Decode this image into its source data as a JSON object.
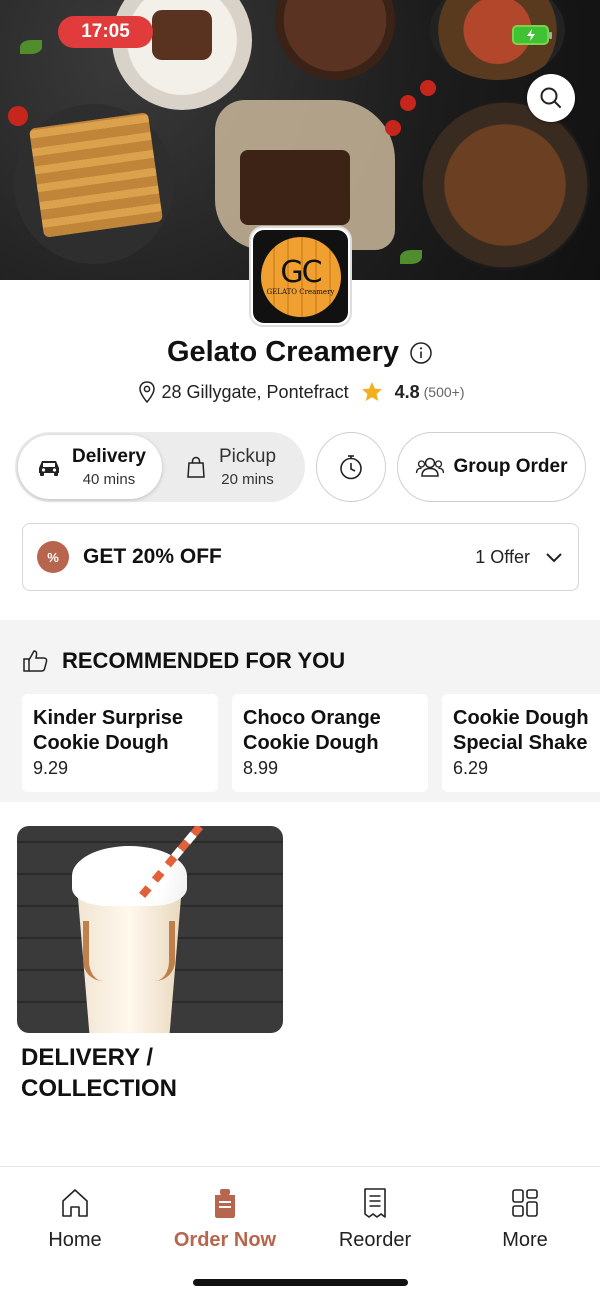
{
  "status_bar": {
    "time": "17:05",
    "battery_icon": "battery-charging-icon"
  },
  "header": {
    "search_icon": "search-icon"
  },
  "store": {
    "name": "Gelato Creamery",
    "logo_text": "GC",
    "logo_subtext": "GELATO Creamery",
    "address": "28 Gillygate, Pontefract",
    "rating": "4.8",
    "reviews": "(500+)"
  },
  "modes": {
    "delivery": {
      "label": "Delivery",
      "time": "40 mins"
    },
    "pickup": {
      "label": "Pickup",
      "time": "20 mins"
    },
    "group_order": "Group Order"
  },
  "offer": {
    "badge": "%",
    "title": "GET 20% OFF",
    "count": "1 Offer"
  },
  "recommended": {
    "title": "RECOMMENDED FOR YOU",
    "items": [
      {
        "name": "Kinder Surprise Cookie Dough",
        "price": "9.29"
      },
      {
        "name": "Choco Orange Cookie Dough",
        "price": "8.99"
      },
      {
        "name": "Cookie Dough Special Shake",
        "price": "6.29"
      }
    ]
  },
  "category": {
    "label": "DELIVERY / COLLECTION"
  },
  "nav": {
    "items": [
      {
        "label": "Home",
        "icon": "home-icon"
      },
      {
        "label": "Order Now",
        "icon": "order-icon"
      },
      {
        "label": "Reorder",
        "icon": "receipt-icon"
      },
      {
        "label": "More",
        "icon": "grid-icon"
      }
    ],
    "active": "Order Now"
  },
  "colors": {
    "accent": "#b8654e",
    "time_pill": "#e23b3b",
    "battery": "#3fc334",
    "star": "#f2b01e"
  }
}
